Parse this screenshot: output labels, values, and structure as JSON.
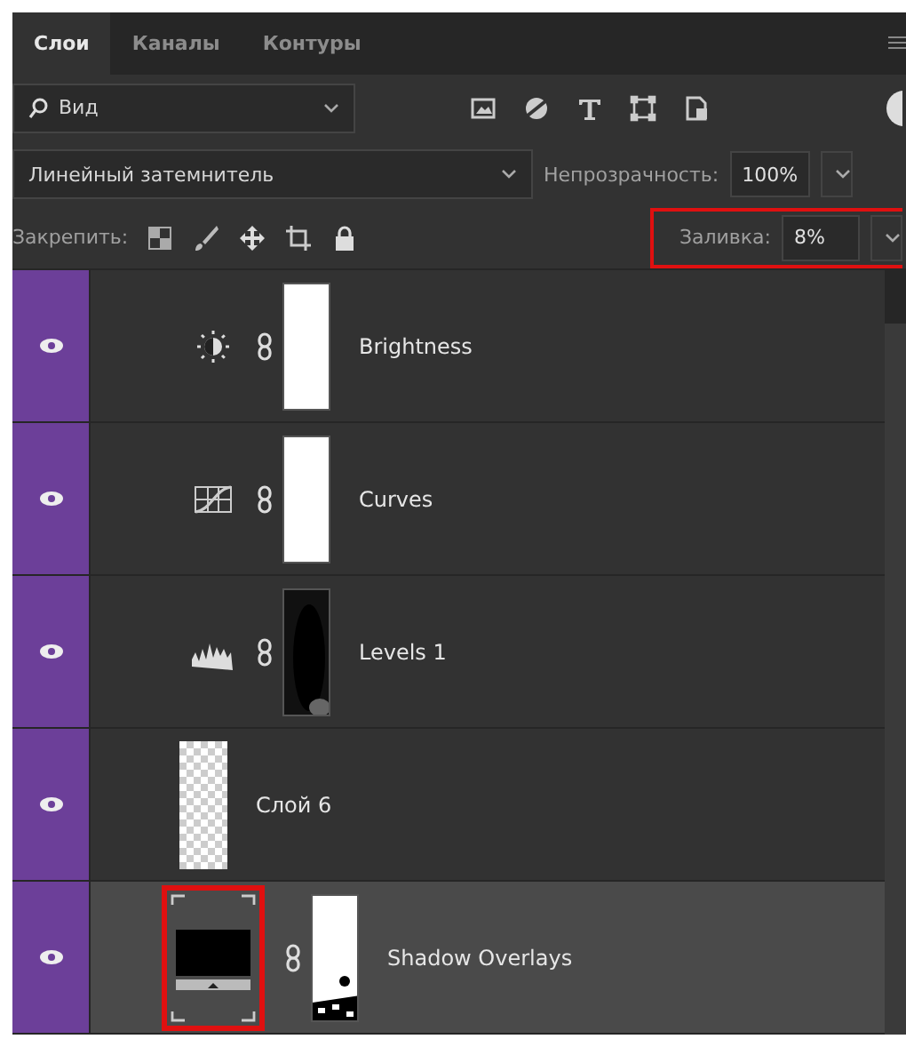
{
  "tabs": [
    {
      "label": "Слои",
      "selected": true
    },
    {
      "label": "Каналы",
      "selected": false
    },
    {
      "label": "Контуры",
      "selected": false
    }
  ],
  "filter": {
    "value": "Вид"
  },
  "blend_mode": {
    "value": "Линейный затемнитель"
  },
  "opacity": {
    "label": "Непрозрачность:",
    "value": "100%"
  },
  "lock": {
    "label": "Закрепить:"
  },
  "fill": {
    "label": "Заливка:",
    "value": "8%",
    "highlighted": true
  },
  "layers": [
    {
      "name": "Brightness",
      "kind": "adjustment",
      "adjustment": {
        "kind": "brightness"
      },
      "mask": {
        "kind": "white"
      },
      "visible": true,
      "selected": false
    },
    {
      "name": "Curves",
      "kind": "adjustment",
      "adjustment": {
        "kind": "curves"
      },
      "mask": {
        "kind": "white"
      },
      "visible": true,
      "selected": false
    },
    {
      "name": "Levels 1",
      "kind": "adjustment",
      "adjustment": {
        "kind": "levels"
      },
      "mask": {
        "kind": "dark"
      },
      "visible": true,
      "selected": false
    },
    {
      "name": "Слой 6",
      "kind": "pixel",
      "visible": true,
      "selected": false
    },
    {
      "name": "Shadow Overlays",
      "kind": "smart",
      "mask": {
        "kind": "noisy"
      },
      "visible": true,
      "selected": true,
      "highlighted": true
    }
  ]
}
